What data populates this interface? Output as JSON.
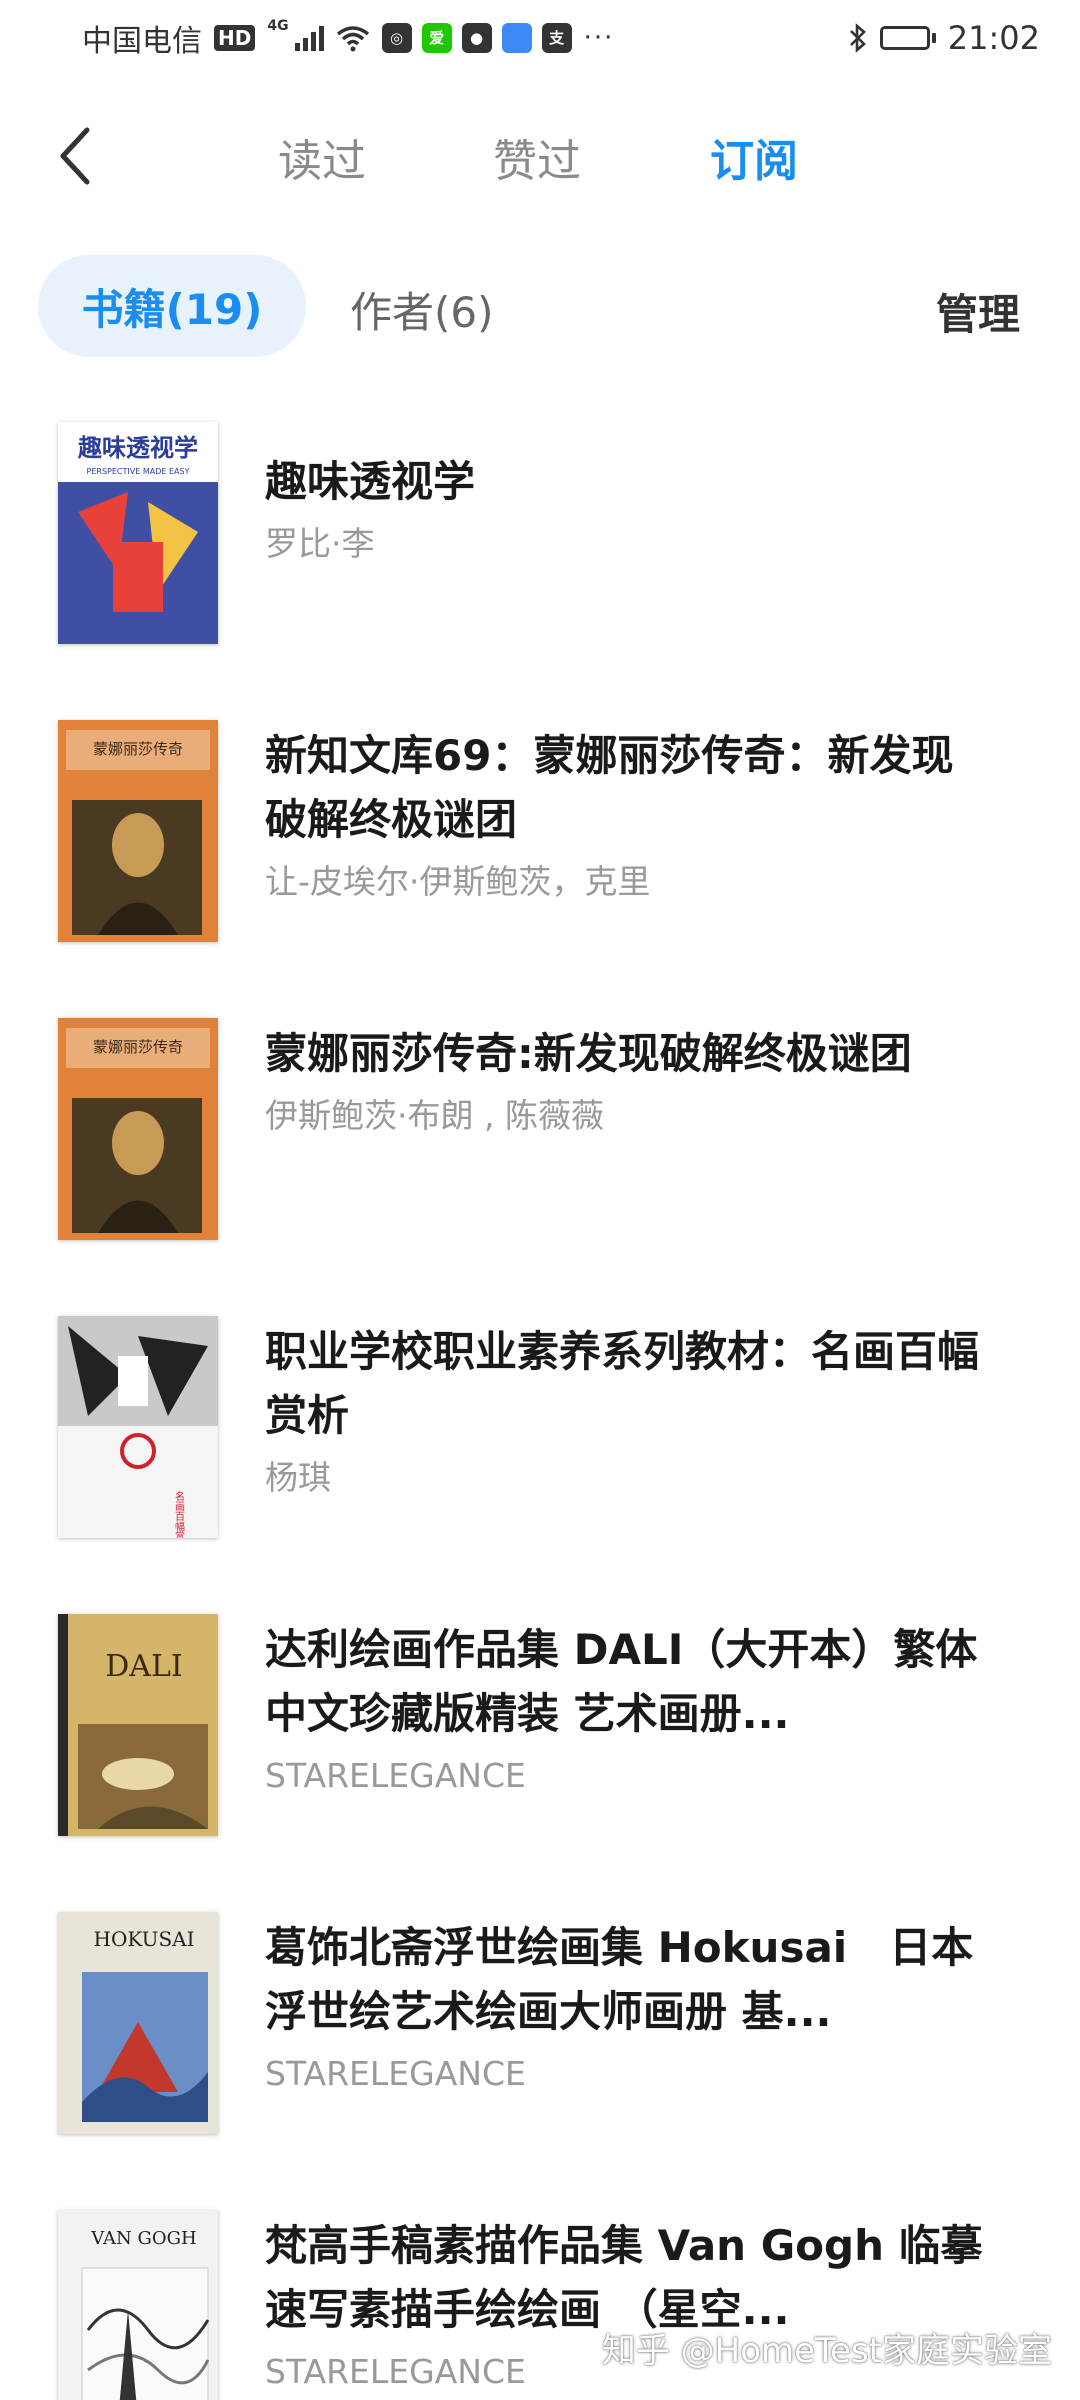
{
  "status_bar": {
    "carrier": "中国电信",
    "hd_badge": "HD",
    "network": "4G",
    "apps": [
      {
        "name": "netease-music",
        "color": "#333333",
        "glyph": "◎"
      },
      {
        "name": "iqiyi",
        "color": "#1ec800",
        "glyph": "爱"
      },
      {
        "name": "message-bubble",
        "color": "#333333",
        "glyph": "●"
      },
      {
        "name": "app-blue",
        "color": "#3d8af7",
        "glyph": ""
      },
      {
        "name": "alipay",
        "color": "#333333",
        "glyph": "支"
      }
    ],
    "more": "···",
    "time": "21:02"
  },
  "nav": {
    "tabs": [
      {
        "label": "读过",
        "active": false
      },
      {
        "label": "赞过",
        "active": false
      },
      {
        "label": "订阅",
        "active": true
      }
    ]
  },
  "sub_tabs": {
    "books": "书籍(19)",
    "authors": "作者(6)",
    "manage": "管理"
  },
  "books": [
    {
      "title": "趣味透视学",
      "author": "罗比·李",
      "cover": {
        "text_main": "趣味透视学",
        "text_sub": "PERSPECTIVE MADE EASY",
        "colors": [
          "#2a3d9a",
          "#e8413a",
          "#f3c443"
        ]
      }
    },
    {
      "title": "新知文库69：蒙娜丽莎传奇：新发现破解终极谜团",
      "author": "让-皮埃尔·伊斯鲍茨，克里",
      "cover": {
        "text_main": "蒙娜丽莎传奇",
        "colors": [
          "#e0823a",
          "#4a3a22",
          "#c79a55"
        ]
      }
    },
    {
      "title": "蒙娜丽莎传奇:新发现破解终极谜团",
      "author": "伊斯鲍茨·布朗 , 陈薇薇",
      "cover": {
        "text_main": "蒙娜丽莎传奇",
        "colors": [
          "#e0823a",
          "#4a3a22",
          "#c79a55"
        ]
      }
    },
    {
      "title": "职业学校职业素养系列教材：名画百幅赏析",
      "author": "杨琪",
      "cover": {
        "text_main": "名画百幅赏析",
        "colors": [
          "#222222",
          "#c9c9c9",
          "#d0212b"
        ]
      }
    },
    {
      "title": "达利绘画作品集 DALI（大开本）繁体中文珍藏版精装 艺术画册...",
      "author": "STARELEGANCE",
      "cover": {
        "text_main": "DALI",
        "colors": [
          "#d4b56a",
          "#5a4a2a",
          "#8a6a3a"
        ]
      }
    },
    {
      "title": "葛饰北斋浮世绘画集 Hokusai　日本浮世绘艺术绘画大师画册 基...",
      "author": "STARELEGANCE",
      "cover": {
        "text_main": "HOKUSAI",
        "colors": [
          "#2f4d86",
          "#c2392b",
          "#e9e4d8"
        ]
      }
    },
    {
      "title": "梵高手稿素描作品集  Van Gogh 临摹速写素描手绘绘画 （星空...",
      "author": "STARELEGANCE",
      "cover": {
        "text_main": "VAN GOGH",
        "colors": [
          "#f2f2f2",
          "#333333",
          "#777777"
        ]
      }
    }
  ],
  "watermark": "知乎 @HomeTest家庭实验室",
  "colors": {
    "accent": "#1a8ef0",
    "pill_bg": "#e8f2fc",
    "muted": "#999999"
  }
}
